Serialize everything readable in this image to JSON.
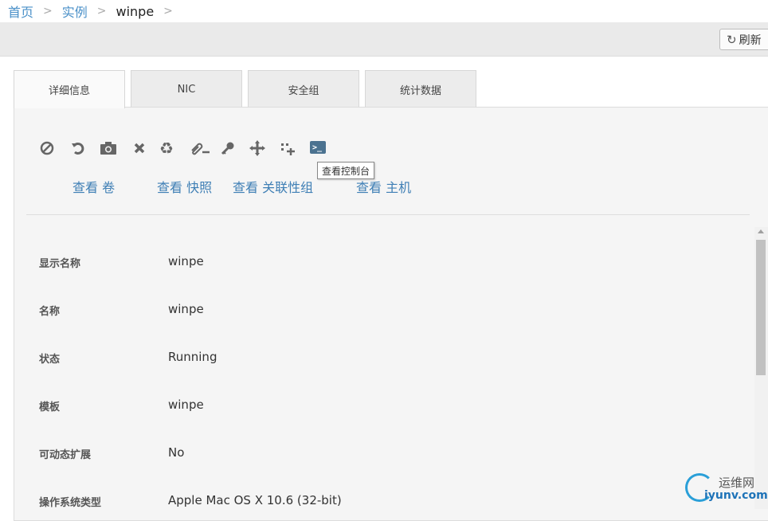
{
  "breadcrumb": {
    "items": [
      "首页",
      "实例"
    ],
    "current": "winpe",
    "separator": ">"
  },
  "toolbar": {
    "refresh_label": "刷新",
    "refresh_icon": "refresh-icon"
  },
  "tabs": [
    {
      "label": "详细信息",
      "active": true
    },
    {
      "label": "NIC",
      "active": false
    },
    {
      "label": "安全组",
      "active": false
    },
    {
      "label": "统计数据",
      "active": false
    }
  ],
  "actions": {
    "icons": [
      "stop-icon",
      "reboot-icon",
      "snapshot-icon",
      "destroy-icon",
      "recycle-icon",
      "attach-iso-icon",
      "key-icon",
      "migrate-icon",
      "scale-icon",
      "console-icon"
    ],
    "console_glyph": ">_",
    "tooltip": "查看控制台"
  },
  "view_links": [
    "查看 卷",
    "查看 快照",
    "查看 关联性组",
    "查看 主机"
  ],
  "details": [
    {
      "label": "显示名称",
      "value": "winpe"
    },
    {
      "label": "名称",
      "value": "winpe"
    },
    {
      "label": "状态",
      "value": "Running"
    },
    {
      "label": "模板",
      "value": "winpe"
    },
    {
      "label": "可动态扩展",
      "value": "No"
    },
    {
      "label": "操作系统类型",
      "value": "Apple Mac OS X 10.6 (32-bit)"
    }
  ],
  "watermark": {
    "cn": "运维网",
    "en": "iyunv.com"
  },
  "colors": {
    "link": "#4a90c8",
    "console_bg": "#4b7290",
    "watermark": "#1e73b8"
  }
}
